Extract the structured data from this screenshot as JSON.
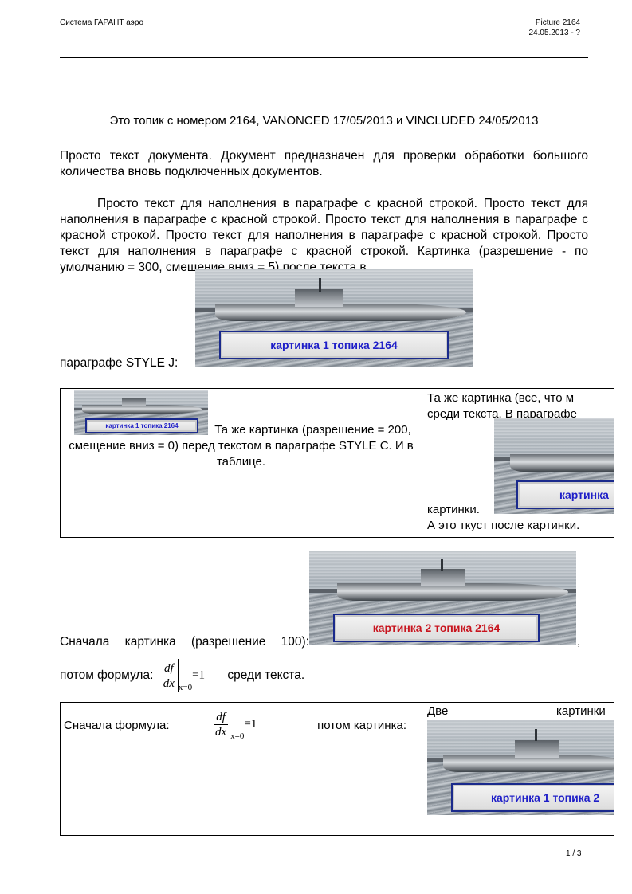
{
  "header": {
    "left": "Система ГАРАНТ аэро",
    "right_line1": "Picture 2164",
    "right_line2": "24.05.2013 - ?"
  },
  "title": "Это топик с номером 2164, VANONCED 17/05/2013 и VINCLUDED 24/05/2013",
  "para1": "Просто текст документа. Документ предназначен для проверки обработки большого количества вновь подключенных документов.",
  "para2": "Просто текст для наполнения в параграфе с красной строкой. Просто текст для наполнения в параграфе с красной строкой. Просто текст для наполнения в параграфе с красной строкой. Просто текст для наполнения в параграфе с красной строкой. Просто текст для наполнения в параграфе с красной строкой. Картинка (разрешение - по умолчанию = 300, смещение вниз = 5) после текста в",
  "para2_tail": "параграфе STYLE J:",
  "images": {
    "label1": "картинка 1 топика 2164",
    "label1_small": "картинка 1 топика 2164",
    "label2": "картинка 2 топика 2164",
    "label_cut": "картинка",
    "label1_cut": "картинка 1 топика 2"
  },
  "table1": {
    "left_text": "Та же картинка (разрешение = 200, смещение вниз = 0) перед текстом в параграфе STYLE C. И в таблице.",
    "right_line1": "Та же картинка (все, что м",
    "right_line2": "среди текста. В параграфе",
    "right_after": "картинки.",
    "right_last": "А это ткуст после картинки."
  },
  "para3_start": "Сначала картинка (разрешение 100):",
  "para3_comma": ",",
  "para3_formula_pre": "потом формула:",
  "para3_formula_post": "среди текста.",
  "formula": {
    "num": "df",
    "den": "dx",
    "sub": "x=0",
    "eq": "=1"
  },
  "table2": {
    "left_pre": "Сначала формула:",
    "left_post": "потом картинка:",
    "right_word1": "Две",
    "right_word2": "картинки"
  },
  "footer": {
    "page": "1 / 3"
  }
}
